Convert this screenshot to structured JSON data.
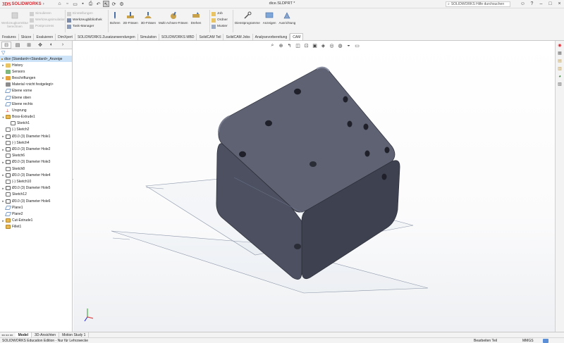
{
  "app": {
    "logo_ds": "3DS",
    "logo_text": "SOLIDWORKS",
    "doc_title": "dice.SLDPRT *",
    "search_placeholder": "SOLIDWORKS Hilfe durchsuchen"
  },
  "ribbon": {
    "tool_correction": "Werkzeugkorrektur berechnen",
    "simulate": "Simulieren",
    "tool_simulation": "Werkzeugsimulation",
    "postprocess": "Postprozess",
    "settings": "Einstellungen",
    "tool_library": "Werkzeugbibliothek",
    "task_manager": "Task-Manager",
    "drilling": "Bohren",
    "milling_2d": "2D-Fräsen",
    "milling_3d": "3D-Fräsen",
    "multiaxis": "Multi-Achsen-Fräsen",
    "turning": "Drehen",
    "job": "Job",
    "folder": "Ordner",
    "pattern": "Muster",
    "service_programs": "Dienstprogramme",
    "display": "Anzeigen",
    "alignment": "Ausrichtung"
  },
  "tabs": [
    {
      "label": "Features",
      "active": false
    },
    {
      "label": "Skizze",
      "active": false
    },
    {
      "label": "Evaluieren",
      "active": false
    },
    {
      "label": "DimXpert",
      "active": false
    },
    {
      "label": "SOLIDWORKS Zusatzanwendungen",
      "active": false
    },
    {
      "label": "Simulation",
      "active": false
    },
    {
      "label": "SOLIDWORKS MBD",
      "active": false
    },
    {
      "label": "SolidCAM Teil",
      "active": false
    },
    {
      "label": "SolidCAM Jobs",
      "active": false
    },
    {
      "label": "Analysevorbereitung",
      "active": false
    },
    {
      "label": "CAM",
      "active": true
    }
  ],
  "tree": {
    "root": "dice (Standard<<Standard>_Anzeige",
    "items": [
      {
        "label": "History",
        "icon": "folder",
        "exp": "►",
        "indent": 0
      },
      {
        "label": "Sensors",
        "icon": "sensor",
        "exp": "",
        "indent": 0
      },
      {
        "label": "Beschriftungen",
        "icon": "annot",
        "exp": "►",
        "indent": 0
      },
      {
        "label": "Material <nicht festgelegt>",
        "icon": "mat",
        "exp": "",
        "indent": 0
      },
      {
        "label": "Ebene vorne",
        "icon": "plane",
        "exp": "",
        "indent": 0
      },
      {
        "label": "Ebene oben",
        "icon": "plane",
        "exp": "",
        "indent": 0
      },
      {
        "label": "Ebene rechts",
        "icon": "plane",
        "exp": "",
        "indent": 0
      },
      {
        "label": "Ursprung",
        "icon": "origin",
        "exp": "",
        "indent": 0
      },
      {
        "label": "Boss-Extrude1",
        "icon": "feat",
        "exp": "▼",
        "indent": 0
      },
      {
        "label": "Sketch1",
        "icon": "sketch",
        "exp": "",
        "indent": 1
      },
      {
        "label": "(-) Sketch2",
        "icon": "sketch",
        "exp": "",
        "indent": 0
      },
      {
        "label": "Ø3.0 (3) Diameter Hole1",
        "icon": "hole",
        "exp": "►",
        "indent": 0
      },
      {
        "label": "(-) Sketch4",
        "icon": "sketch",
        "exp": "",
        "indent": 0
      },
      {
        "label": "Ø3.0 (3) Diameter Hole2",
        "icon": "hole",
        "exp": "►",
        "indent": 0
      },
      {
        "label": "Sketch6",
        "icon": "sketch",
        "exp": "",
        "indent": 0
      },
      {
        "label": "Ø3.0 (3) Diameter Hole3",
        "icon": "hole",
        "exp": "►",
        "indent": 0
      },
      {
        "label": "Sketch8",
        "icon": "sketch",
        "exp": "",
        "indent": 0
      },
      {
        "label": "Ø3.0 (3) Diameter Hole4",
        "icon": "hole",
        "exp": "►",
        "indent": 0
      },
      {
        "label": "(-) Sketch10",
        "icon": "sketch",
        "exp": "",
        "indent": 0
      },
      {
        "label": "Ø3.0 (3) Diameter Hole5",
        "icon": "hole",
        "exp": "►",
        "indent": 0
      },
      {
        "label": "Sketch12",
        "icon": "sketch",
        "exp": "",
        "indent": 0
      },
      {
        "label": "Ø3.0 (3) Diameter Hole6",
        "icon": "hole",
        "exp": "►",
        "indent": 0
      },
      {
        "label": "Plane1",
        "icon": "plane",
        "exp": "",
        "indent": 0
      },
      {
        "label": "Plane2",
        "icon": "plane",
        "exp": "",
        "indent": 0
      },
      {
        "label": "Cut-Extrude1",
        "icon": "cut",
        "exp": "►",
        "indent": 0
      },
      {
        "label": "Fillet1",
        "icon": "fillet",
        "exp": "",
        "indent": 0
      }
    ]
  },
  "bottom": {
    "tabs": [
      {
        "label": "Model",
        "active": true
      },
      {
        "label": "3D-Ansichten",
        "active": false
      },
      {
        "label": "Motion Study 1",
        "active": false
      }
    ]
  },
  "status": {
    "edition": "SOLIDWORKS Education Edition - Nur für Lehrzwecke",
    "mode": "Bearbeiten Teil",
    "units": "MMGS"
  },
  "colors": {
    "die_top": "#5e6272",
    "die_front": "#4d5060",
    "die_side": "#3e4150",
    "accent": "#d8262e",
    "selection": "#cde3f7"
  }
}
